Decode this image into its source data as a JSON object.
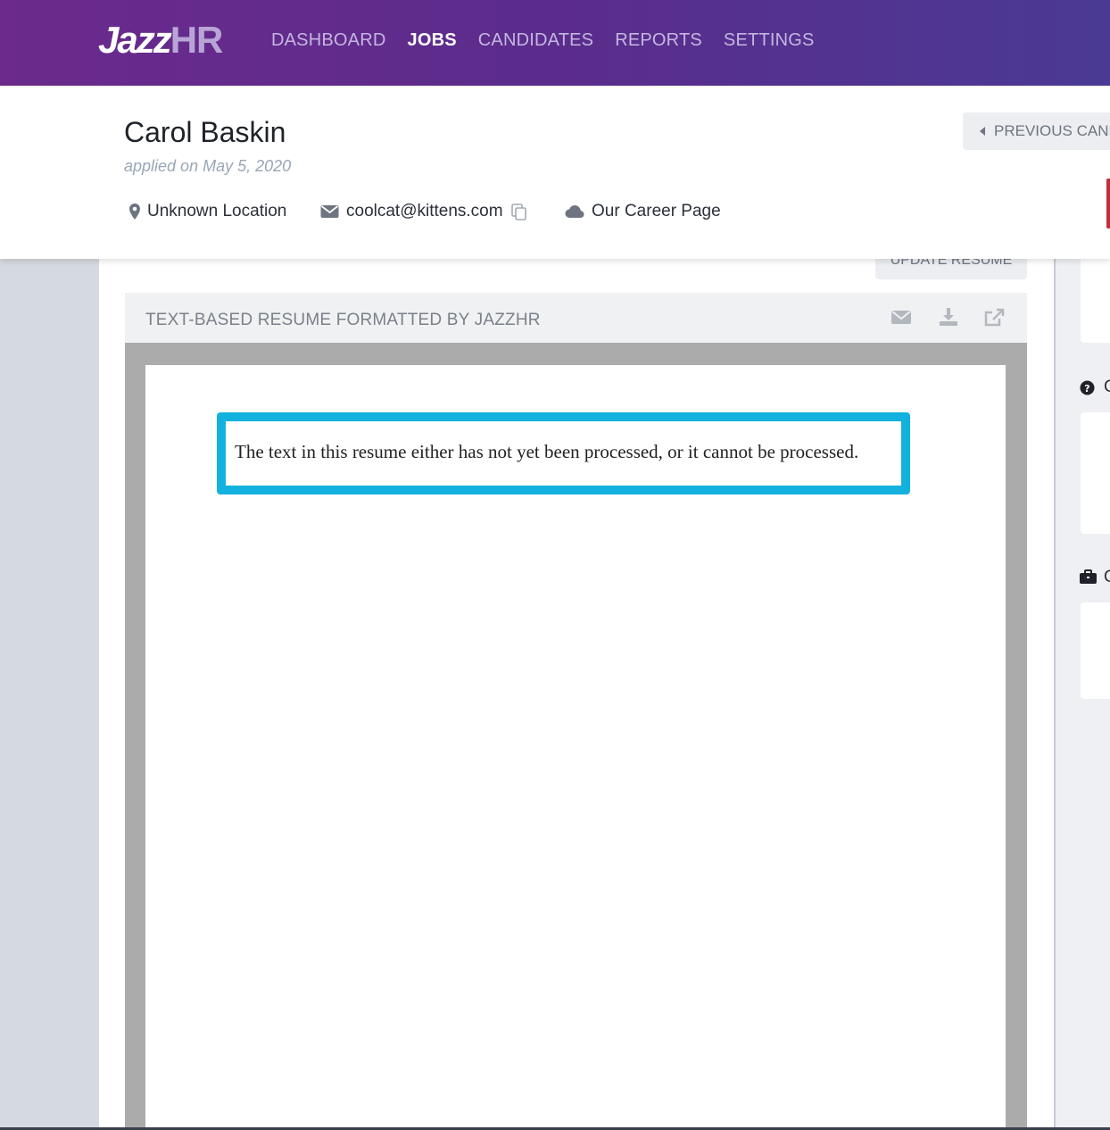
{
  "brand": {
    "logo_main": "Jazz",
    "logo_accent": "HR"
  },
  "nav": {
    "items": [
      {
        "label": "DASHBOARD",
        "active": false
      },
      {
        "label": "JOBS",
        "active": true
      },
      {
        "label": "CANDIDATES",
        "active": false
      },
      {
        "label": "REPORTS",
        "active": false
      },
      {
        "label": "SETTINGS",
        "active": false
      }
    ]
  },
  "candidate": {
    "name": "Carol Baskin",
    "applied": "applied on May 5, 2020",
    "location": "Unknown Location",
    "email": "coolcat@kittens.com",
    "source": "Our Career Page"
  },
  "header_actions": {
    "previous_label": "PREVIOUS CAND"
  },
  "resume": {
    "title": "Resume",
    "update_label": "UPDATE RESUME",
    "bar_label": "TEXT-BASED RESUME FORMATTED BY JAZZHR",
    "message": "The text in this resume either has not yet been processed, or it cannot be processed."
  },
  "right_panel": {
    "section_1_initial": "C",
    "section_2_initial": "C"
  },
  "colors": {
    "highlight": "#12b1de",
    "nav_start": "#6b2a8c",
    "nav_end": "#4a3a94"
  }
}
